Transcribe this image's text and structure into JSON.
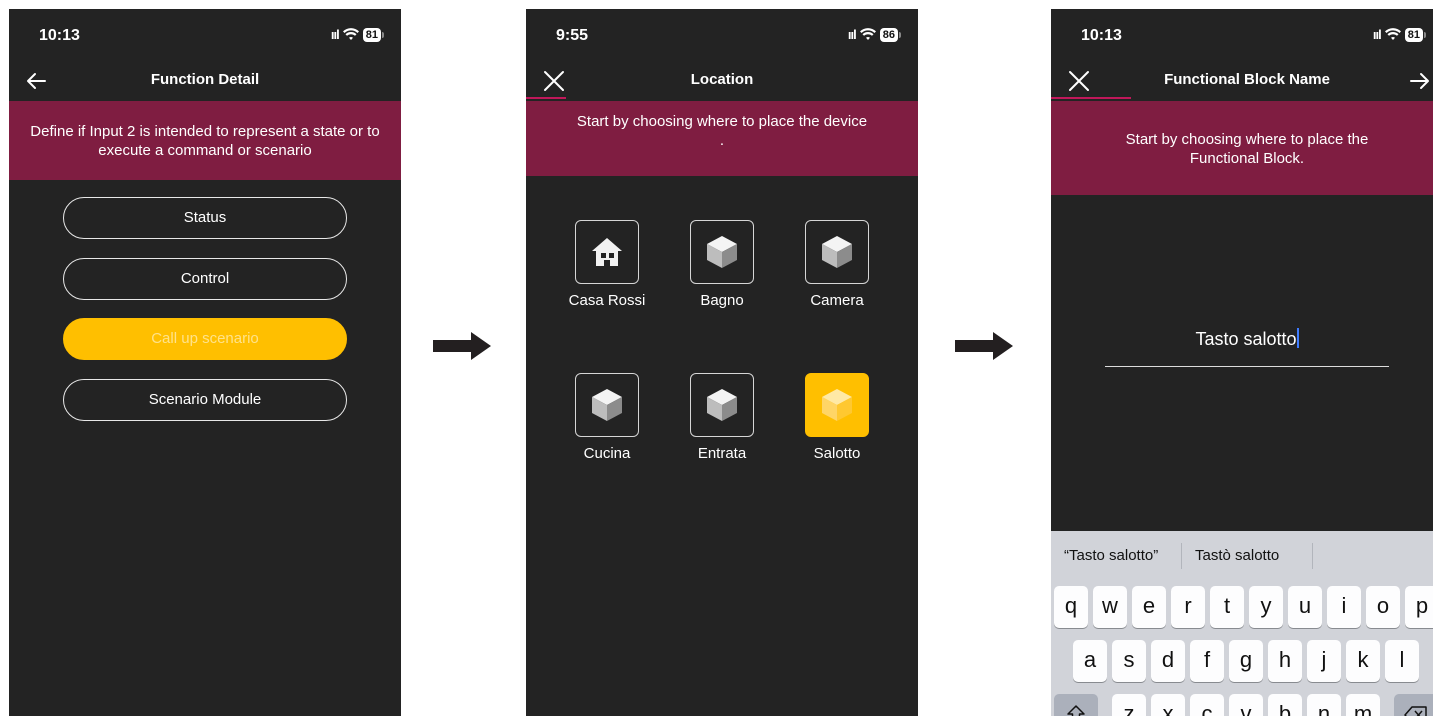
{
  "screen1": {
    "status": {
      "time": "10:13",
      "battery": "81"
    },
    "title": "Function Detail",
    "banner": "Define if Input 2 is intended to represent a state or to execute a command or scenario",
    "options": [
      {
        "label": "Status",
        "selected": false
      },
      {
        "label": "Control",
        "selected": false
      },
      {
        "label": "Call up scenario",
        "selected": true
      },
      {
        "label": "Scenario Module",
        "selected": false
      }
    ]
  },
  "screen2": {
    "status": {
      "time": "9:55",
      "battery": "86"
    },
    "title": "Location",
    "banner": "Start by choosing where to place the device",
    "banner_dot": ".",
    "locations": [
      {
        "label": "Casa Rossi",
        "icon": "house-icon",
        "selected": false
      },
      {
        "label": "Bagno",
        "icon": "cube-icon",
        "selected": false
      },
      {
        "label": "Camera",
        "icon": "cube-icon",
        "selected": false
      },
      {
        "label": "Cucina",
        "icon": "cube-icon",
        "selected": false
      },
      {
        "label": "Entrata",
        "icon": "cube-icon",
        "selected": false
      },
      {
        "label": "Salotto",
        "icon": "cube-icon",
        "selected": true
      }
    ]
  },
  "screen3": {
    "status": {
      "time": "10:13",
      "battery": "81"
    },
    "title": "Functional Block Name",
    "banner": "Start by choosing where to place the Functional Block.",
    "name_value": "Tasto salotto",
    "suggestions": [
      "“Tasto salotto”",
      "Tastò salotto"
    ],
    "keys": {
      "row1": [
        "q",
        "w",
        "e",
        "r",
        "t",
        "y",
        "u",
        "i",
        "o",
        "p"
      ],
      "row2": [
        "a",
        "s",
        "d",
        "f",
        "g",
        "h",
        "j",
        "k",
        "l"
      ],
      "row3": [
        "z",
        "x",
        "c",
        "v",
        "b",
        "n",
        "m"
      ]
    }
  },
  "colors": {
    "accent": "#ffbf00",
    "banner": "#7f1d41",
    "background": "#232323",
    "tab_indicator": "#c0185a"
  }
}
